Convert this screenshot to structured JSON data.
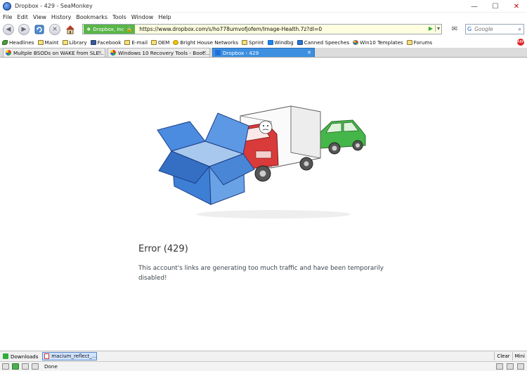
{
  "window": {
    "title": "Dropbox - 429 - SeaMonkey",
    "controls": {
      "minimize": "—",
      "maximize": "☐",
      "close": "✕"
    }
  },
  "menu": [
    "File",
    "Edit",
    "View",
    "History",
    "Bookmarks",
    "Tools",
    "Window",
    "Help"
  ],
  "navigation": {
    "site_identity": "Dropbox, Inc",
    "url": "https://www.dropbox.com/s/ho778umvofjofem/Image-Health.7z?dl=0",
    "search_placeholder": "Google"
  },
  "bookmarks": [
    {
      "label": "Headlines",
      "icon": "leaf-icon"
    },
    {
      "label": "Maint",
      "icon": "folder-icon"
    },
    {
      "label": "Library",
      "icon": "folder-icon"
    },
    {
      "label": "Facebook",
      "icon": "facebook-icon"
    },
    {
      "label": "E-mail",
      "icon": "folder-icon"
    },
    {
      "label": "OEM",
      "icon": "folder-icon"
    },
    {
      "label": "Bright House Networks",
      "icon": "gold-icon"
    },
    {
      "label": "Sprint",
      "icon": "folder-icon"
    },
    {
      "label": "Windbg",
      "icon": "blue-icon"
    },
    {
      "label": "Canned Speeches",
      "icon": "blue-icon"
    },
    {
      "label": "Win10 Templates",
      "icon": "color-icon"
    },
    {
      "label": "Forums",
      "icon": "folder-icon"
    }
  ],
  "tabs": [
    {
      "label": "Multple BSODs on WAKE from SLE...",
      "active": false
    },
    {
      "label": "Windows 10 Recovery Tools - Boot...",
      "active": false
    },
    {
      "label": "Dropbox - 429",
      "active": true
    }
  ],
  "page": {
    "error_title": "Error (429)",
    "error_message": "This account's links are generating too much traffic and have been temporarily disabled!"
  },
  "downloads": {
    "label": "Downloads",
    "item": "macium_reflect_...",
    "clear": "Clear",
    "mini": "Mini"
  },
  "status": {
    "text": "Done"
  },
  "colors": {
    "active_tab": "#3d8fe0",
    "dropbox_blue": "#2b73d6",
    "truck_red": "#d93a3a",
    "car_green": "#45b64a",
    "site_identity_green": "#59b548"
  }
}
